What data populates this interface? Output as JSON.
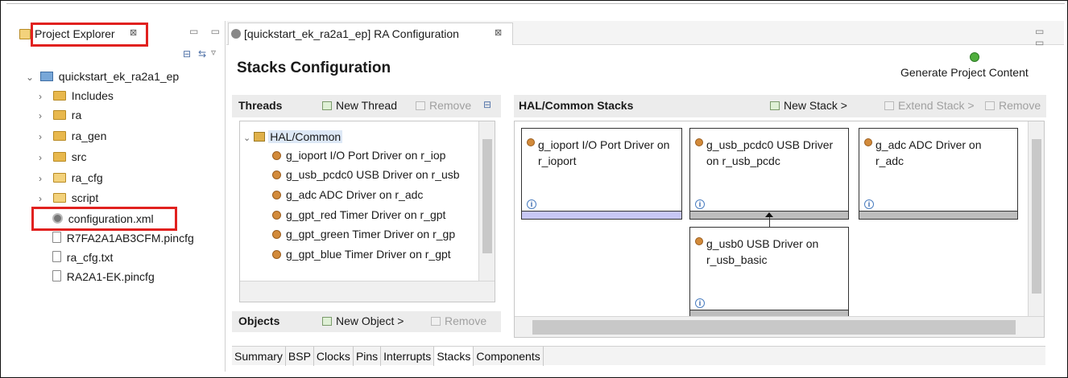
{
  "left_panel": {
    "title": "Project Explorer",
    "close": "⊠",
    "controls": "▭ ▭",
    "tree": [
      {
        "label": "quickstart_ek_ra2a1_ep",
        "depth": 0,
        "arrow": "⌄"
      },
      {
        "label": "Includes",
        "depth": 1,
        "arrow": "›"
      },
      {
        "label": "ra",
        "depth": 1,
        "arrow": "›"
      },
      {
        "label": "ra_gen",
        "depth": 1,
        "arrow": "›"
      },
      {
        "label": "src",
        "depth": 1,
        "arrow": "›"
      },
      {
        "label": "ra_cfg",
        "depth": 1,
        "arrow": "›"
      },
      {
        "label": "script",
        "depth": 1,
        "arrow": "›"
      },
      {
        "label": "configuration.xml",
        "depth": 1,
        "arrow": ""
      },
      {
        "label": "R7FA2A1AB3CFM.pincfg",
        "depth": 1,
        "arrow": ""
      },
      {
        "label": "ra_cfg.txt",
        "depth": 1,
        "arrow": ""
      },
      {
        "label": "RA2A1-EK.pincfg",
        "depth": 1,
        "arrow": ""
      }
    ]
  },
  "editor": {
    "tab_title": "[quickstart_ek_ra2a1_ep] RA Configuration",
    "tab_close": "⊠",
    "section_title": "Stacks Configuration",
    "generate_label": "Generate Project Content"
  },
  "threads": {
    "title": "Threads",
    "new_thread": "New Thread",
    "remove": "Remove",
    "items": [
      "HAL/Common",
      "g_ioport I/O Port Driver on r_iop",
      "g_usb_pcdc0 USB Driver on r_usb",
      "g_adc ADC Driver on r_adc",
      "g_gpt_red Timer Driver on r_gpt",
      "g_gpt_green Timer Driver on r_gp",
      "g_gpt_blue Timer Driver on r_gpt"
    ]
  },
  "hal": {
    "title": "HAL/Common Stacks",
    "new_stack": "New Stack >",
    "extend_stack": "Extend Stack >",
    "remove": "Remove",
    "cards": [
      {
        "title": "g_ioport I/O Port Driver on r_ioport",
        "footer_color": "#c7c7f5"
      },
      {
        "title": "g_usb_pcdc0 USB Driver on r_usb_pcdc",
        "footer_color": "#bdbdbd"
      },
      {
        "title": "g_adc ADC Driver on r_adc",
        "footer_color": "#bdbdbd"
      },
      {
        "title": "g_usb0 USB Driver on r_usb_basic",
        "footer_color": "#bdbdbd"
      }
    ],
    "info_icon": "i"
  },
  "objects": {
    "title": "Objects",
    "new_object": "New Object >",
    "remove": "Remove"
  },
  "bottom_tabs": [
    "Summary",
    "BSP",
    "Clocks",
    "Pins",
    "Interrupts",
    "Stacks",
    "Components"
  ],
  "colors": {
    "highlight_red": "#e1211f",
    "selected_blue": "#c7c7f5",
    "header_grey": "#ececec"
  }
}
